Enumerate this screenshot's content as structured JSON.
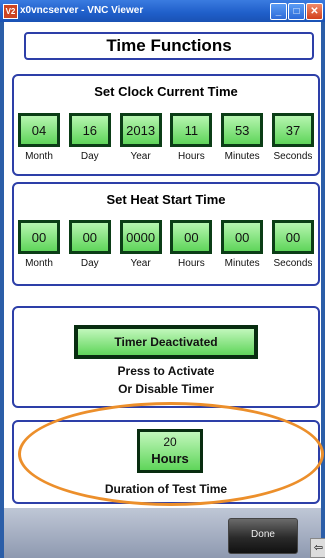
{
  "window": {
    "title": "x0vncserver - VNC Viewer",
    "app_icon": "V2",
    "buttons": [
      "_",
      "□",
      "✕"
    ]
  },
  "header": {
    "title": "Time Functions"
  },
  "clock": {
    "title": "Set Clock Current Time",
    "fields": [
      {
        "label": "Month",
        "value": "04"
      },
      {
        "label": "Day",
        "value": "16"
      },
      {
        "label": "Year",
        "value": "2013"
      },
      {
        "label": "Hours",
        "value": "11"
      },
      {
        "label": "Minutes",
        "value": "53"
      },
      {
        "label": "Seconds",
        "value": "37"
      }
    ]
  },
  "heat": {
    "title": "Set Heat Start Time",
    "fields": [
      {
        "label": "Month",
        "value": "00"
      },
      {
        "label": "Day",
        "value": "00"
      },
      {
        "label": "Year",
        "value": "0000"
      },
      {
        "label": "Hours",
        "value": "00"
      },
      {
        "label": "Minutes",
        "value": "00"
      },
      {
        "label": "Seconds",
        "value": "00"
      }
    ]
  },
  "timer": {
    "button_label": "Timer Deactivated",
    "line1": "Press to Activate",
    "line2": "Or Disable Timer"
  },
  "duration": {
    "value": "20",
    "unit": "Hours",
    "caption": "Duration of Test Time"
  },
  "footer": {
    "done_label": "Done",
    "side_arrow": "⇦"
  },
  "colors": {
    "accent_green": "#5fd55a",
    "panel_border": "#2d3fa8",
    "highlight": "#ec8f2b"
  }
}
